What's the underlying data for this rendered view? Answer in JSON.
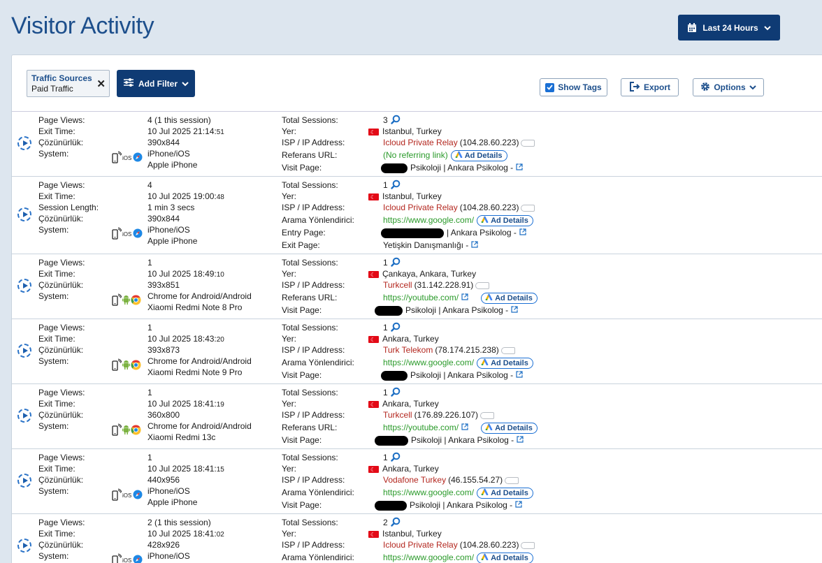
{
  "title": "Visitor Activity",
  "range_label": "Last 24 Hours",
  "filter": {
    "title": "Traffic Sources",
    "value": "Paid Traffic"
  },
  "add_filter_label": "Add Filter",
  "show_tags_label": "Show Tags",
  "export_label": "Export",
  "options_label": "Options",
  "ad_details_label": "Ad Details",
  "colors": {
    "brand": "#0f3b74",
    "isp": "#b3261e",
    "link": "#2a9a2a"
  },
  "rows": [
    {
      "left": [
        [
          "Page Views:",
          "4 (1 this session)",
          ""
        ],
        [
          "Exit Time:",
          "10 Jul 2025 21:14:",
          "51"
        ],
        [
          "Çözünürlük:",
          "390x844",
          ""
        ],
        [
          "System:",
          "iPhone/iOS",
          ""
        ],
        [
          "",
          "Apple iPhone",
          ""
        ]
      ],
      "right": [
        {
          "label": "Total Sessions:",
          "value": "3",
          "kind": "sessions"
        },
        {
          "label": "Yer:",
          "value": "Istanbul, Turkey",
          "kind": "loc"
        },
        {
          "label": "ISP / IP Address:",
          "isp": "Icloud Private Relay",
          "ip": "(104.28.60.223)",
          "kind": "isp"
        },
        {
          "label": "Referans URL:",
          "value": "(No referring link)",
          "kind": "ref-noext"
        },
        {
          "label": "Visit Page:",
          "value": "Psikoloji | Ankara Psikolog -",
          "kind": "page",
          "redact": 38
        }
      ],
      "platform": "ios"
    },
    {
      "left": [
        [
          "Page Views:",
          "4",
          ""
        ],
        [
          "Exit Time:",
          "10 Jul 2025 19:00:",
          "48"
        ],
        [
          "Session Length:",
          "1 min 3 secs",
          ""
        ],
        [
          "Çözünürlük:",
          "390x844",
          ""
        ],
        [
          "System:",
          "iPhone/iOS",
          ""
        ],
        [
          "",
          "Apple iPhone",
          ""
        ]
      ],
      "right": [
        {
          "label": "Total Sessions:",
          "value": "1",
          "kind": "sessions"
        },
        {
          "label": "Yer:",
          "value": "Istanbul, Turkey",
          "kind": "loc"
        },
        {
          "label": "ISP / IP Address:",
          "isp": "Icloud Private Relay",
          "ip": "(104.28.60.223)",
          "kind": "isp"
        },
        {
          "label": "Arama Yönlendirici:",
          "value": "https://www.google.com/",
          "kind": "ref-noext"
        },
        {
          "label": "Entry Page:",
          "value": "| Ankara Psikolog -",
          "kind": "page",
          "redact": 90
        },
        {
          "label": "Exit Page:",
          "value": "Yetişkin Danışmanlığı -",
          "kind": "page",
          "redact": 0
        }
      ],
      "platform": "ios"
    },
    {
      "left": [
        [
          "Page Views:",
          "1",
          ""
        ],
        [
          "Exit Time:",
          "10 Jul 2025 18:49:",
          "10"
        ],
        [
          "Çözünürlük:",
          "393x851",
          ""
        ],
        [
          "System:",
          "Chrome for Android/Android",
          ""
        ],
        [
          "",
          "Xiaomi Redmi Note 8 Pro",
          ""
        ]
      ],
      "right": [
        {
          "label": "Total Sessions:",
          "value": "1",
          "kind": "sessions"
        },
        {
          "label": "Yer:",
          "value": "Çankaya, Ankara, Turkey",
          "kind": "loc"
        },
        {
          "label": "ISP / IP Address:",
          "isp": "Turkcell",
          "ip": "(31.142.228.91)",
          "kind": "isp"
        },
        {
          "label": "Referans URL:",
          "value": "https://youtube.com/",
          "kind": "ref-ext"
        },
        {
          "label": "Visit Page:",
          "value": "Psikoloji | Ankara Psikolog -",
          "kind": "page",
          "redact": 40
        }
      ],
      "platform": "android"
    },
    {
      "left": [
        [
          "Page Views:",
          "1",
          ""
        ],
        [
          "Exit Time:",
          "10 Jul 2025 18:43:",
          "20"
        ],
        [
          "Çözünürlük:",
          "393x873",
          ""
        ],
        [
          "System:",
          "Chrome for Android/Android",
          ""
        ],
        [
          "",
          "Xiaomi Redmi Note 9 Pro",
          ""
        ]
      ],
      "right": [
        {
          "label": "Total Sessions:",
          "value": "1",
          "kind": "sessions"
        },
        {
          "label": "Yer:",
          "value": "Ankara, Turkey",
          "kind": "loc"
        },
        {
          "label": "ISP / IP Address:",
          "isp": "Turk Telekom",
          "ip": "(78.174.215.238)",
          "kind": "isp"
        },
        {
          "label": "Arama Yönlendirici:",
          "value": "https://www.google.com/",
          "kind": "ref-noext"
        },
        {
          "label": "Visit Page:",
          "value": "Psikoloji | Ankara Psikolog -",
          "kind": "page",
          "redact": 38
        }
      ],
      "platform": "android"
    },
    {
      "left": [
        [
          "Page Views:",
          "1",
          ""
        ],
        [
          "Exit Time:",
          "10 Jul 2025 18:41:",
          "19"
        ],
        [
          "Çözünürlük:",
          "360x800",
          ""
        ],
        [
          "System:",
          "Chrome for Android/Android",
          ""
        ],
        [
          "",
          "Xiaomi Redmi 13c",
          ""
        ]
      ],
      "right": [
        {
          "label": "Total Sessions:",
          "value": "1",
          "kind": "sessions"
        },
        {
          "label": "Yer:",
          "value": "Ankara, Turkey",
          "kind": "loc"
        },
        {
          "label": "ISP / IP Address:",
          "isp": "Turkcell",
          "ip": "(176.89.226.107)",
          "kind": "isp"
        },
        {
          "label": "Referans URL:",
          "value": "https://youtube.com/",
          "kind": "ref-ext"
        },
        {
          "label": "Visit Page:",
          "value": "Psikoloji | Ankara Psikolog -",
          "kind": "page",
          "redact": 48
        }
      ],
      "platform": "android"
    },
    {
      "left": [
        [
          "Page Views:",
          "1",
          ""
        ],
        [
          "Exit Time:",
          "10 Jul 2025 18:41:",
          "15"
        ],
        [
          "Çözünürlük:",
          "440x956",
          ""
        ],
        [
          "System:",
          "iPhone/iOS",
          ""
        ],
        [
          "",
          "Apple iPhone",
          ""
        ]
      ],
      "right": [
        {
          "label": "Total Sessions:",
          "value": "1",
          "kind": "sessions"
        },
        {
          "label": "Yer:",
          "value": "Ankara, Turkey",
          "kind": "loc"
        },
        {
          "label": "ISP / IP Address:",
          "isp": "Vodafone Turkey",
          "ip": "(46.155.54.27)",
          "kind": "isp"
        },
        {
          "label": "Arama Yönlendirici:",
          "value": "https://www.google.com/",
          "kind": "ref-noext"
        },
        {
          "label": "Visit Page:",
          "value": "Psikoloji | Ankara Psikolog -",
          "kind": "page",
          "redact": 46
        }
      ],
      "platform": "ios"
    },
    {
      "left": [
        [
          "Page Views:",
          "2 (1 this session)",
          ""
        ],
        [
          "Exit Time:",
          "10 Jul 2025 18:41:",
          "02"
        ],
        [
          "Çözünürlük:",
          "428x926",
          ""
        ],
        [
          "System:",
          "iPhone/iOS",
          ""
        ]
      ],
      "right": [
        {
          "label": "Total Sessions:",
          "value": "2",
          "kind": "sessions"
        },
        {
          "label": "Yer:",
          "value": "Istanbul, Turkey",
          "kind": "loc"
        },
        {
          "label": "ISP / IP Address:",
          "isp": "Icloud Private Relay",
          "ip": "(104.28.60.223)",
          "kind": "isp"
        },
        {
          "label": "Arama Yönlendirici:",
          "value": "https://www.google.com/",
          "kind": "ref-noext"
        }
      ],
      "platform": "ios"
    }
  ]
}
